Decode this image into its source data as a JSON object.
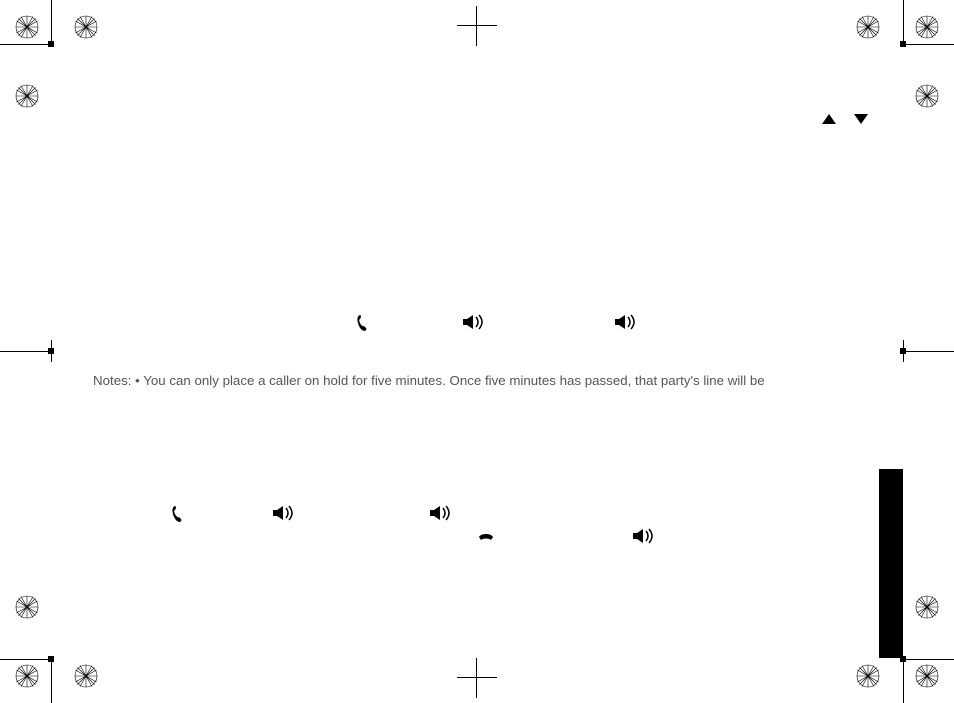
{
  "triangles": {
    "up_name": "up-arrow-icon",
    "down_name": "down-arrow-icon"
  },
  "body": {
    "line1": "Notes: • You can only place a caller on hold for five minutes. Once five minutes has passed, that party's line will be"
  },
  "icons": {
    "receiver": "receiver-icon",
    "speaker": "speaker-icon",
    "hangup": "hangup-icon"
  }
}
